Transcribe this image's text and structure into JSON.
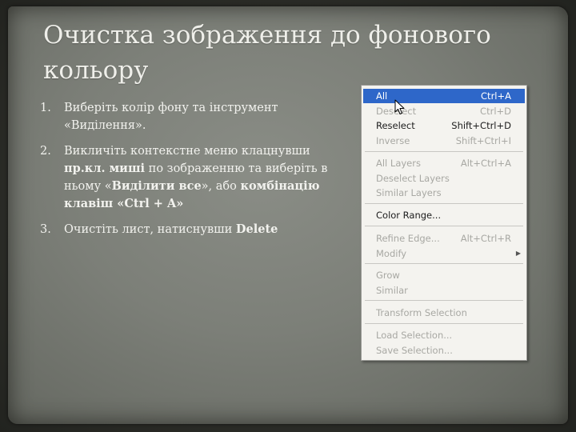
{
  "slide": {
    "title": "Очистка зображення до фонового кольору",
    "steps": [
      {
        "num": "1.",
        "parts": [
          "Виберіть колір фону та інструмент «Виділення»."
        ]
      },
      {
        "num": "2.",
        "parts": [
          "Викличіть контекстне меню клацнувши ",
          "пр.кл. миші",
          " по зображенню та виберіть в ньому «",
          "Виділити все",
          "», або ",
          "комбінацію клавіш «Ctrl + A»"
        ]
      },
      {
        "num": "3.",
        "parts": [
          "Очистіть лист, натиснувши ",
          "Delete"
        ]
      }
    ]
  },
  "context_menu": {
    "items": [
      {
        "label": "All",
        "shortcut": "Ctrl+A"
      },
      {
        "label": "Deselect",
        "shortcut": "Ctrl+D"
      },
      {
        "label": "Reselect",
        "shortcut": "Shift+Ctrl+D"
      },
      {
        "label": "Inverse",
        "shortcut": "Shift+Ctrl+I"
      },
      {
        "label": "All Layers",
        "shortcut": "Alt+Ctrl+A"
      },
      {
        "label": "Deselect Layers",
        "shortcut": ""
      },
      {
        "label": "Similar Layers",
        "shortcut": ""
      },
      {
        "label": "Color Range...",
        "shortcut": ""
      },
      {
        "label": "Refine Edge...",
        "shortcut": "Alt+Ctrl+R"
      },
      {
        "label": "Modify",
        "shortcut": ""
      },
      {
        "label": "Grow",
        "shortcut": ""
      },
      {
        "label": "Similar",
        "shortcut": ""
      },
      {
        "label": "Transform Selection",
        "shortcut": ""
      },
      {
        "label": "Load Selection...",
        "shortcut": ""
      },
      {
        "label": "Save Selection...",
        "shortcut": ""
      }
    ],
    "highlight_color": "#2e67c9",
    "submenu_icon": "triangle-right-icon",
    "pointer_icon": "mouse-pointer-icon"
  }
}
